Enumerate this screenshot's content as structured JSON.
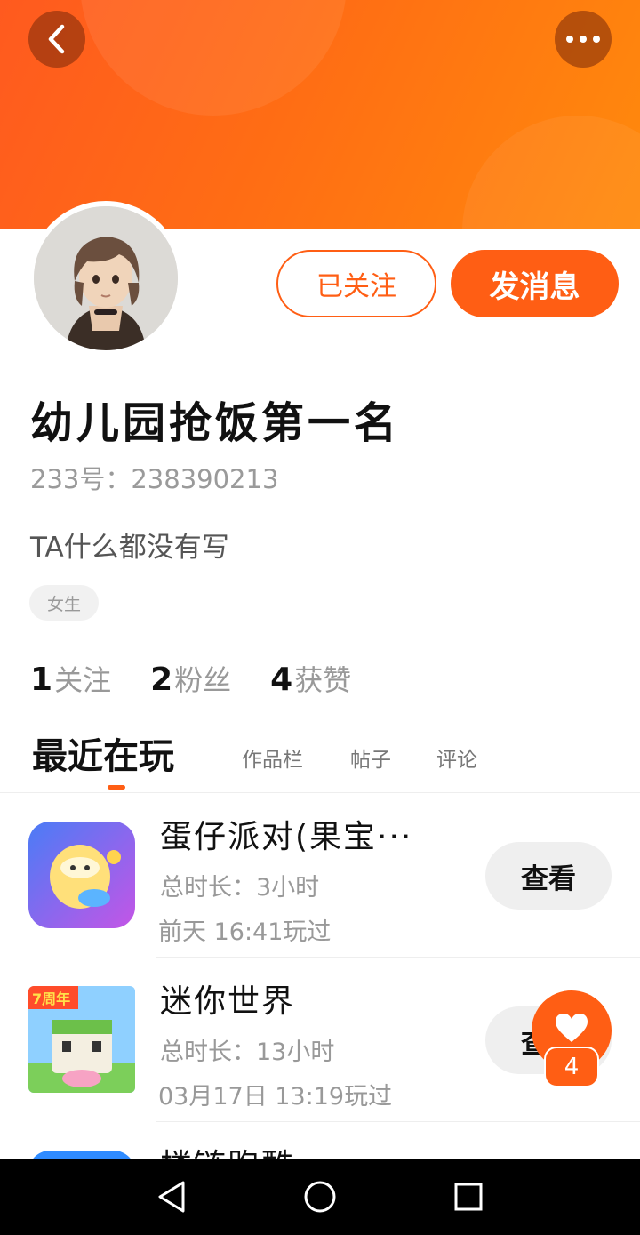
{
  "header": {
    "back_icon": "chevron-left-icon",
    "more_icon": "more-dots-icon",
    "banner_color": "#ff6d14"
  },
  "profile": {
    "follow_label": "已关注",
    "message_label": "发消息",
    "nickname": "幼儿园抢饭第一名",
    "uid": "233号：238390213",
    "bio": "TA什么都没有写",
    "gender_tag": "女生"
  },
  "stats": [
    {
      "value": "1",
      "label": "关注"
    },
    {
      "value": "2",
      "label": "粉丝"
    },
    {
      "value": "4",
      "label": "获赞"
    }
  ],
  "tabs": [
    {
      "label": "最近在玩",
      "active": true
    },
    {
      "label": "作品栏",
      "active": false
    },
    {
      "label": "帖子",
      "active": false
    },
    {
      "label": "评论",
      "active": false
    }
  ],
  "games": [
    {
      "name": "蛋仔派对(果宝···",
      "duration": "总时长：3小时",
      "last_played": "前天 16:41玩过",
      "button": "查看"
    },
    {
      "name": "迷你世界",
      "duration": "总时长：13小时",
      "last_played": "03月17日 13:19玩过",
      "button": "查看",
      "icon_badge": "7周年"
    },
    {
      "name": "楼链跑酷",
      "duration": "",
      "last_played": "",
      "button": ""
    }
  ],
  "like_fab": {
    "icon": "heart-icon",
    "count": "4"
  },
  "navbar": {
    "back": "triangle-back-icon",
    "home": "circle-home-icon",
    "recents": "square-recents-icon"
  },
  "accent_color": "#ff5e14"
}
